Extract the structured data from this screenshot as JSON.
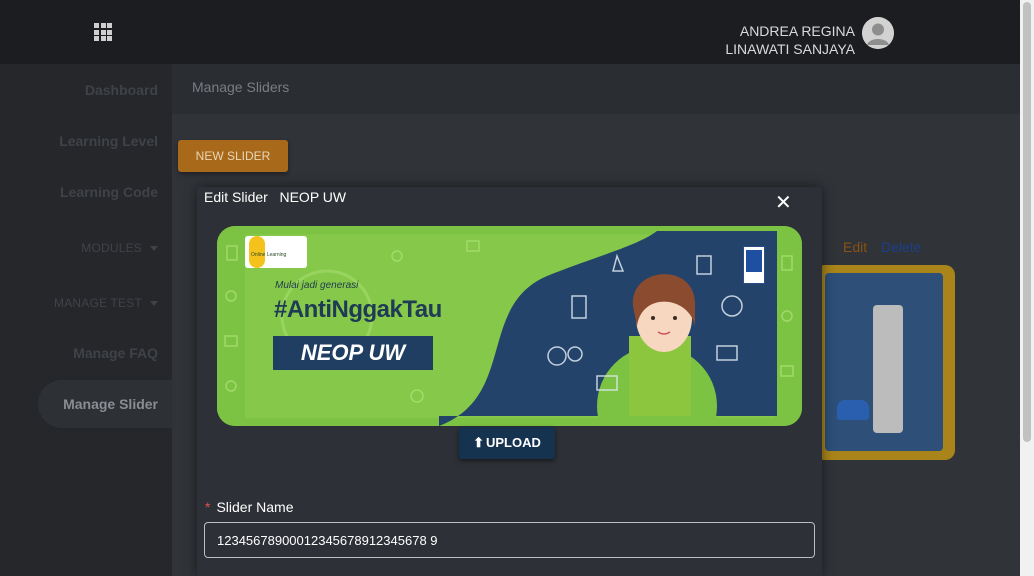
{
  "header": {
    "menu_icon": "apps-grid-icon",
    "user_name_line1": "ANDREA REGINA",
    "user_name_line2": "LINAWATI SANJAYA",
    "avatar_icon": "user-avatar-icon"
  },
  "sidebar": {
    "items": [
      {
        "label": "Dashboard"
      },
      {
        "label": "Learning Level"
      },
      {
        "label": "Learning Code"
      },
      {
        "label": "MODULES"
      },
      {
        "label": "MANAGE TEST"
      },
      {
        "label": "Manage FAQ"
      },
      {
        "label": "Manage Slider"
      }
    ]
  },
  "page": {
    "title": "Manage Sliders",
    "new_button": "NEW SLIDER",
    "edit_link": "Edit",
    "delete_link": "Delete"
  },
  "modal": {
    "title": "Edit Slider",
    "subtitle": "NEOP UW",
    "close_icon": "close-icon",
    "banner": {
      "logo_text": "Online Learning",
      "tagline": "Mulai jadi generasi",
      "hashtag": "#AntiNggakTau",
      "name": "NEOP UW"
    },
    "upload_label": "UPLOAD",
    "upload_icon": "upload-icon",
    "field_label": "Slider Name",
    "field_value": "12345678900012345678912345678 9"
  },
  "colors": {
    "accent_orange": "#a86a1a",
    "upload_blue": "#15324f",
    "banner_green": "#7cc243",
    "banner_navy": "#23436a"
  }
}
